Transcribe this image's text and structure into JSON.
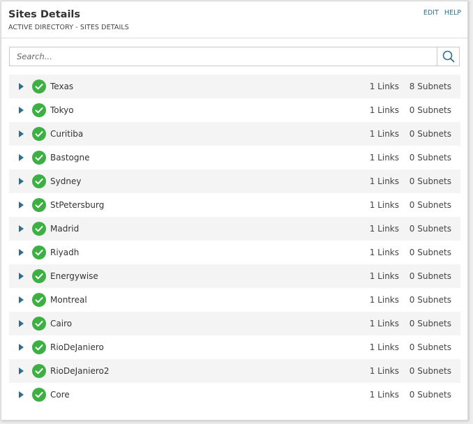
{
  "header": {
    "title": "Sites Details",
    "subtitle": "ACTIVE DIRECTORY - SITES DETAILS",
    "edit_label": "EDIT",
    "help_label": "HELP"
  },
  "search": {
    "placeholder": "Search...",
    "value": "",
    "icon": "search-icon"
  },
  "colors": {
    "accent": "#2e6f8e",
    "status_ok": "#3cb043",
    "alt_row": "#f4f4f4"
  },
  "sites": [
    {
      "name": "Texas",
      "links": "1 Links",
      "subnets": "8 Subnets"
    },
    {
      "name": "Tokyo",
      "links": "1 Links",
      "subnets": "0 Subnets"
    },
    {
      "name": "Curitiba",
      "links": "1 Links",
      "subnets": "0 Subnets"
    },
    {
      "name": "Bastogne",
      "links": "1 Links",
      "subnets": "0 Subnets"
    },
    {
      "name": "Sydney",
      "links": "1 Links",
      "subnets": "0 Subnets"
    },
    {
      "name": "StPetersburg",
      "links": "1 Links",
      "subnets": "0 Subnets"
    },
    {
      "name": "Madrid",
      "links": "1 Links",
      "subnets": "0 Subnets"
    },
    {
      "name": "Riyadh",
      "links": "1 Links",
      "subnets": "0 Subnets"
    },
    {
      "name": "Energywise",
      "links": "1 Links",
      "subnets": "0 Subnets"
    },
    {
      "name": "Montreal",
      "links": "1 Links",
      "subnets": "0 Subnets"
    },
    {
      "name": "Cairo",
      "links": "1 Links",
      "subnets": "0 Subnets"
    },
    {
      "name": "RioDeJaniero",
      "links": "1 Links",
      "subnets": "0 Subnets"
    },
    {
      "name": "RioDeJaniero2",
      "links": "1 Links",
      "subnets": "0 Subnets"
    },
    {
      "name": "Core",
      "links": "1 Links",
      "subnets": "0 Subnets"
    }
  ]
}
